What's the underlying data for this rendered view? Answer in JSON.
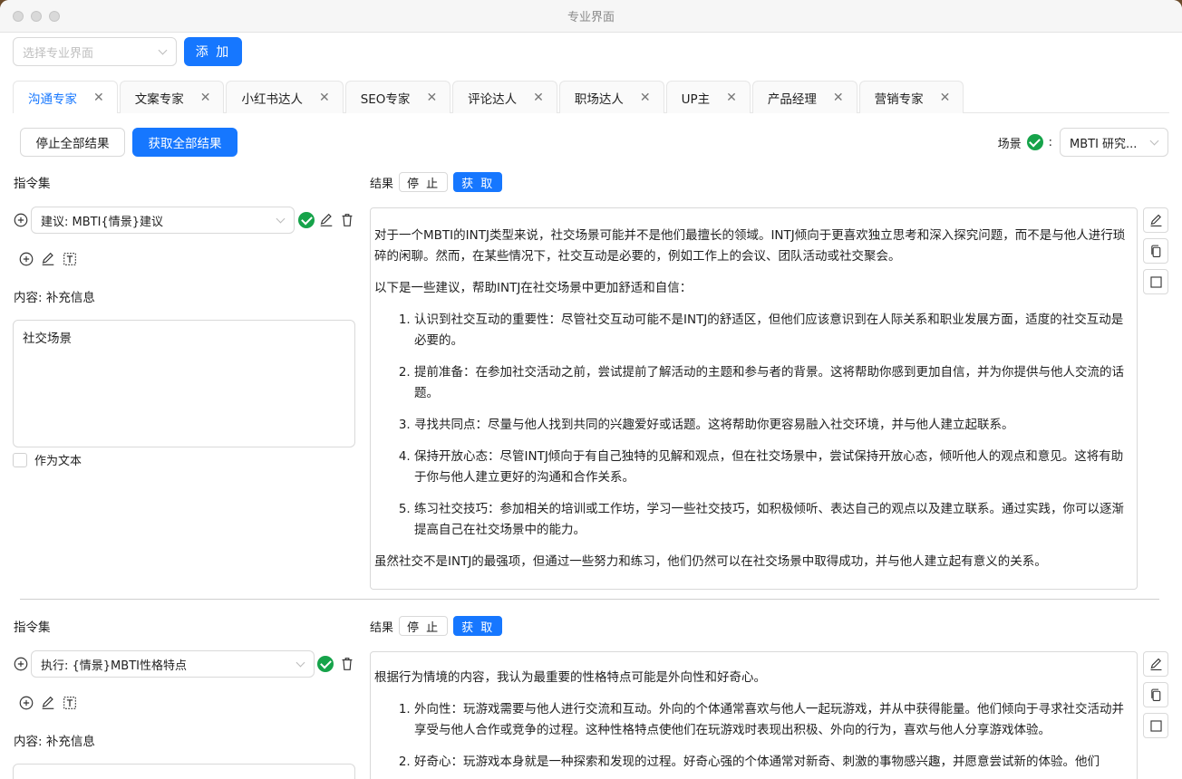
{
  "window": {
    "title": "专业界面"
  },
  "top": {
    "select_placeholder": "选择专业界面",
    "add_label": "添 加"
  },
  "tabs": [
    {
      "label": "沟通专家",
      "active": true
    },
    {
      "label": "文案专家"
    },
    {
      "label": "小红书达人"
    },
    {
      "label": "SEO专家"
    },
    {
      "label": "评论达人"
    },
    {
      "label": "职场达人"
    },
    {
      "label": "UP主"
    },
    {
      "label": "产品经理"
    },
    {
      "label": "营销专家"
    }
  ],
  "toolbar": {
    "stop_all": "停止全部结果",
    "get_all": "获取全部结果",
    "scene_label": "场景",
    "scene_colon": ":",
    "scene_value": "MBTI 研究..."
  },
  "blocks": [
    {
      "instruction_label": "指令集",
      "instruction_value": "建议: MBTI{情景}建议",
      "content_label": "内容: 补充信息",
      "content_value": "社交场景",
      "as_text_label": "作为文本",
      "result_label": "结果",
      "stop_label": "停 止",
      "get_label": "获 取",
      "result": {
        "intro": "对于一个MBTI的INTJ类型来说，社交场景可能并不是他们最擅长的领域。INTJ倾向于更喜欢独立思考和深入探究问题，而不是与他人进行琐碎的闲聊。然而，在某些情况下，社交互动是必要的，例如工作上的会议、团队活动或社交聚会。",
        "lead": "以下是一些建议，帮助INTJ在社交场景中更加舒适和自信：",
        "items": [
          "认识到社交互动的重要性：尽管社交互动可能不是INTJ的舒适区，但他们应该意识到在人际关系和职业发展方面，适度的社交互动是必要的。",
          "提前准备：在参加社交活动之前，尝试提前了解活动的主题和参与者的背景。这将帮助你感到更加自信，并为你提供与他人交流的话题。",
          "寻找共同点：尽量与他人找到共同的兴趣爱好或话题。这将帮助你更容易融入社交环境，并与他人建立起联系。",
          "保持开放心态：尽管INTJ倾向于有自己独特的见解和观点，但在社交场景中，尝试保持开放心态，倾听他人的观点和意见。这将有助于你与他人建立更好的沟通和合作关系。",
          "练习社交技巧：参加相关的培训或工作坊，学习一些社交技巧，如积极倾听、表达自己的观点以及建立联系。通过实践，你可以逐渐提高自己在社交场景中的能力。"
        ],
        "outro": "虽然社交不是INTJ的最强项，但通过一些努力和练习，他们仍然可以在社交场景中取得成功，并与他人建立起有意义的关系。"
      }
    },
    {
      "instruction_label": "指令集",
      "instruction_value": "执行: {情景}MBTI性格特点",
      "content_label": "内容: 补充信息",
      "result_label": "结果",
      "stop_label": "停 止",
      "get_label": "获 取",
      "result": {
        "intro": "根据行为情境的内容，我认为最重要的性格特点可能是外向性和好奇心。",
        "items": [
          "外向性：玩游戏需要与他人进行交流和互动。外向的个体通常喜欢与他人一起玩游戏，并从中获得能量。他们倾向于寻求社交活动并享受与他人合作或竞争的过程。这种性格特点使他们在玩游戏时表现出积极、外向的行为，喜欢与他人分享游戏体验。",
          "好奇心：玩游戏本身就是一种探索和发现的过程。好奇心强的个体通常对新奇、刺激的事物感兴趣，并愿意尝试新的体验。他们"
        ]
      }
    }
  ]
}
